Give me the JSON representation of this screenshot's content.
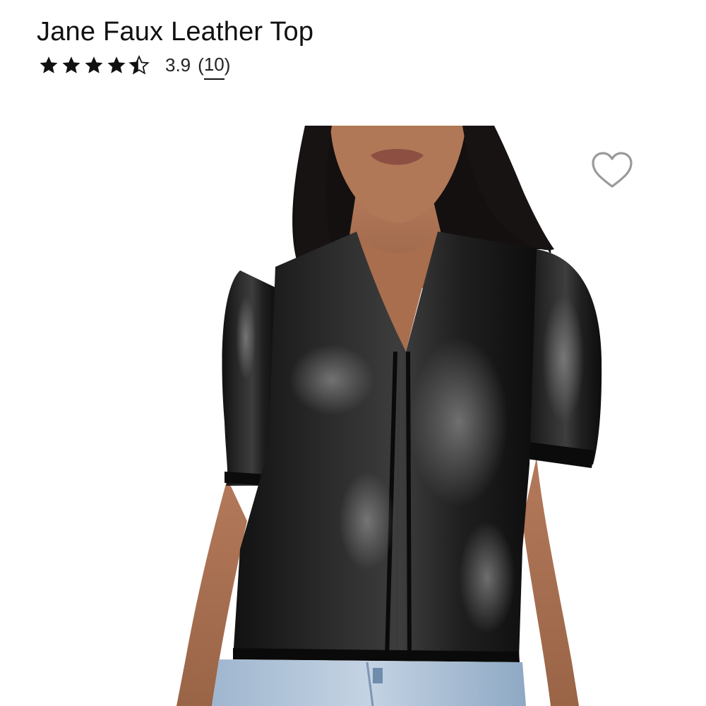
{
  "product": {
    "title": "Jane Faux Leather Top",
    "rating_value": "3.9",
    "rating_open_paren": "(",
    "review_count": "10",
    "rating_close_paren": ")",
    "stars_filled": 3.9,
    "stars_total": 5
  },
  "image": {
    "subject": "model wearing black faux leather short-sleeve top with light wash jeans"
  },
  "icons": {
    "favorite": "heart-outline-icon",
    "star": "star-icon"
  },
  "colors": {
    "text": "#111111",
    "heart_stroke": "#9a9a9a",
    "star_fill": "#111111"
  }
}
